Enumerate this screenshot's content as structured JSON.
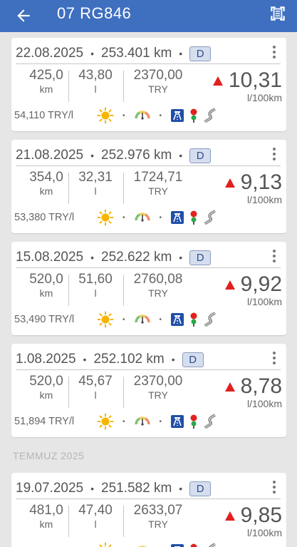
{
  "appbar": {
    "title": "07 RG846",
    "back_icon": "arrow-back-icon",
    "scan_icon": "document-scan-icon",
    "color": "#3f6fbf"
  },
  "labels": {
    "km": "km",
    "l": "l",
    "try": "TRY",
    "cons_unit": "l/100km",
    "badge": "D"
  },
  "section_header": "TEMMUZ 2025",
  "entries": [
    {
      "date": "22.08.2025",
      "odometer": "253.401 km",
      "distance": "425,0",
      "liters": "43,80",
      "cost": "2370,00",
      "consumption": "10,31",
      "price": "54,110 TRY/l",
      "trend": "up"
    },
    {
      "date": "21.08.2025",
      "odometer": "252.976 km",
      "distance": "354,0",
      "liters": "32,31",
      "cost": "1724,71",
      "consumption": "9,13",
      "price": "53,380 TRY/l",
      "trend": "up"
    },
    {
      "date": "15.08.2025",
      "odometer": "252.622 km",
      "distance": "520,0",
      "liters": "51,60",
      "cost": "2760,08",
      "consumption": "9,92",
      "price": "53,490 TRY/l",
      "trend": "up"
    },
    {
      "date": "1.08.2025",
      "odometer": "252.102 km",
      "distance": "520,0",
      "liters": "45,67",
      "cost": "2370,00",
      "consumption": "8,78",
      "price": "51,894 TRY/l",
      "trend": "up"
    },
    {
      "date": "19.07.2025",
      "odometer": "251.582 km",
      "distance": "481,0",
      "liters": "47,40",
      "cost": "2633,07",
      "consumption": "9,85",
      "price": "",
      "trend": "up"
    }
  ],
  "icons": [
    "sun-icon",
    "gauge-icon",
    "highway-icon",
    "traffic-light-icon",
    "winding-road-icon"
  ],
  "colors": {
    "trend_up": "#e02020",
    "badge_fill": "#d5deee",
    "sun": "#f5b400"
  }
}
